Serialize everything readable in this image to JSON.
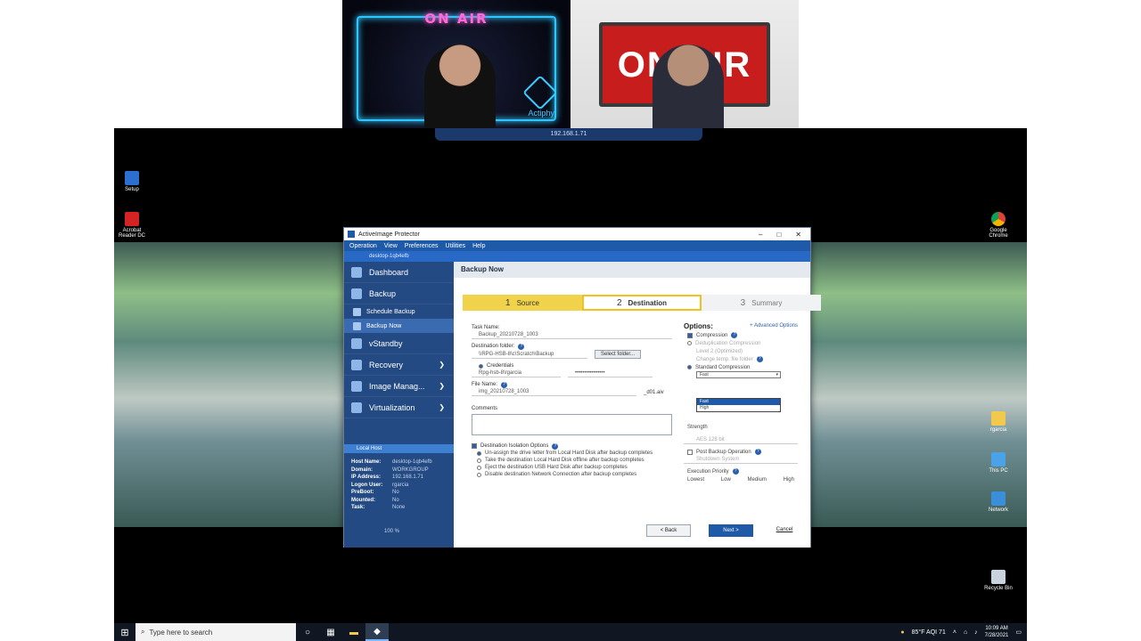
{
  "webcams": {
    "left_sign": "ON AIR",
    "left_brand": "Actiphy",
    "right_sign": "ON AIR"
  },
  "remote_bar": {
    "ip": "192.168.1.71"
  },
  "desktop_icons": {
    "setup": "Setup",
    "acrobat": "Acrobat Reader DC",
    "chrome": "Google Chrome",
    "rgarcia": "rgarcia",
    "this_pc": "This PC",
    "network": "Network",
    "recycle_bin": "Recycle Bin"
  },
  "app": {
    "title": "ActiveImage Protector",
    "menus": [
      "Operation",
      "View",
      "Preferences",
      "Utilities",
      "Help"
    ],
    "host_label": "desktop-1qb4efb",
    "sidebar": {
      "dashboard": "Dashboard",
      "backup": "Backup",
      "schedule_backup": "Schedule Backup",
      "backup_now": "Backup Now",
      "vstandby": "vStandby",
      "recovery": "Recovery",
      "image_manager": "Image Manag...",
      "virtualization": "Virtualization",
      "local_host": "Local Host",
      "host_info": [
        {
          "k": "Host Name:",
          "v": "desktop-1qb4efb"
        },
        {
          "k": "Domain:",
          "v": "WORKGROUP"
        },
        {
          "k": "IP Address:",
          "v": "192.168.1.71"
        },
        {
          "k": "Logon User:",
          "v": "rgarcia"
        },
        {
          "k": "PreBoot:",
          "v": "No"
        },
        {
          "k": "Mounted:",
          "v": "No"
        },
        {
          "k": "Task:",
          "v": "None"
        }
      ],
      "zoom": "100 %"
    },
    "page_title": "Backup Now",
    "steps": [
      {
        "num": "1",
        "label": "Source"
      },
      {
        "num": "2",
        "label": "Destination"
      },
      {
        "num": "3",
        "label": "Summary"
      }
    ],
    "form": {
      "task_name_label": "Task Name:",
      "task_name": "Backup_20210728_1003",
      "dest_folder_label": "Destination folder:",
      "dest_folder": "\\\\RPG-HSB-8\\c\\Scratch\\Backup",
      "select_folder": "Select folder...",
      "credentials_label": "Credentials",
      "cred_user": "Rpg-hsb-8\\rgarcia",
      "cred_pass": "••••••••••••••••",
      "file_name_label": "File Name:",
      "file_name": "img_20210728_1003",
      "file_ext": "_d01.aiv",
      "comments_label": "Comments",
      "isolation_label": "Destination Isolation Options",
      "isolation_options": [
        "Un-assign the drive letter from Local Hard Disk after backup completes",
        "Take the destination Local Hard Disk offline after backup completes",
        "Eject the destination USB Hard Disk after backup completes",
        "Disable destination Network Connection after backup completes"
      ]
    },
    "options": {
      "title": "Options:",
      "advanced": "+ Advanced Options",
      "compression": "Compression",
      "dedup": "Deduplication Compression",
      "dedup_level": "Level 2 (Optimized)",
      "dedup_change": "Change temp. file folder",
      "standard": "Standard Compression",
      "selected": "Fast",
      "dd_items": [
        "Fast",
        "High"
      ],
      "strength": "Strength",
      "encryption": "AES 128 bit",
      "post_backup": "Post Backup Operation",
      "shutdown": "Shutdown System",
      "exec_priority": "Execution Priority",
      "levels": [
        "Lowest",
        "Low",
        "Medium",
        "High"
      ]
    },
    "buttons": {
      "back": "< Back",
      "next": "Next >",
      "cancel": "Cancel"
    }
  },
  "taskbar": {
    "search_placeholder": "Type here to search",
    "weather": "85°F AQI 71",
    "time": "10:09 AM",
    "date": "7/28/2021"
  },
  "colors": {
    "sidebar": "#234a82",
    "menubar": "#1e5aa8",
    "step_active": "#f0c21e",
    "onair_red": "#c81d1d",
    "neon_blue": "#2fc6ff"
  }
}
